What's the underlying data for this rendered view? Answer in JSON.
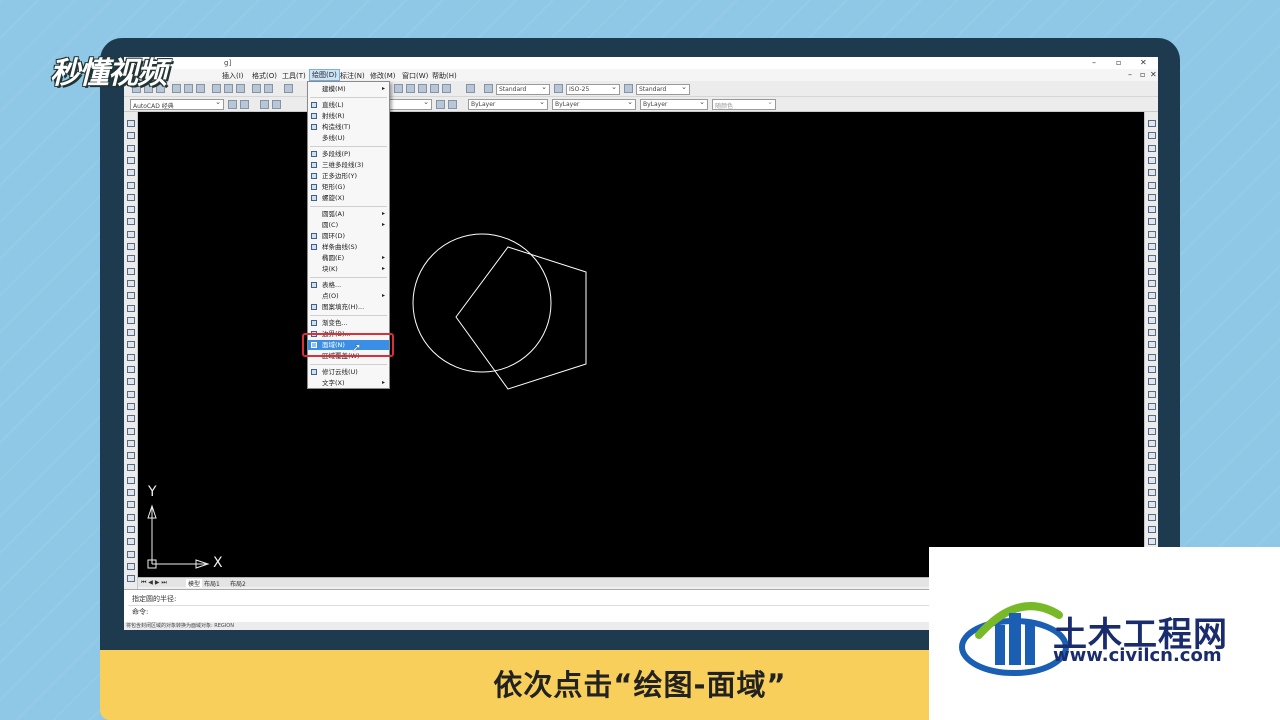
{
  "brand": {
    "logo_text": "秒懂视频"
  },
  "caption": "依次点击“绘图-面域”",
  "watermark": {
    "name": "土木工程网",
    "url": "www.civilcn.com"
  },
  "window": {
    "title_fragment": "g]",
    "controls": [
      "–",
      "▫",
      "✕"
    ],
    "inner_controls": [
      "–",
      "▫",
      "✕"
    ]
  },
  "menubar": {
    "items": [
      {
        "label": "插入(I)"
      },
      {
        "label": "格式(O)"
      },
      {
        "label": "工具(T)"
      },
      {
        "label": "绘图(D)",
        "active": true
      },
      {
        "label": "标注(N)"
      },
      {
        "label": "修改(M)"
      },
      {
        "label": "窗口(W)"
      },
      {
        "label": "帮助(H)"
      }
    ]
  },
  "toolbar": {
    "workspace": "AutoCAD 经典",
    "text_style": "Standard",
    "dim_style": "ISO-25",
    "table_style": "Standard",
    "layer_color": "ByLayer",
    "linetype": "ByLayer",
    "lineweight": "ByLayer",
    "plot_style": "随颜色"
  },
  "draw_menu": {
    "items": [
      {
        "label": "建模(M)",
        "submenu": true,
        "icon": "none"
      },
      {
        "label": "直线(L)",
        "icon": "line-icon"
      },
      {
        "label": "射线(R)",
        "icon": "ray-icon"
      },
      {
        "label": "构造线(T)",
        "icon": "xline-icon"
      },
      {
        "label": "多线(U)",
        "icon": "none"
      },
      {
        "label": "多段线(P)",
        "icon": "polyline-icon"
      },
      {
        "label": "三维多段线(3)",
        "icon": "3dpoly-icon"
      },
      {
        "label": "正多边形(Y)",
        "icon": "polygon-icon"
      },
      {
        "label": "矩形(G)",
        "icon": "rectangle-icon"
      },
      {
        "label": "螺旋(X)",
        "icon": "helix-icon"
      },
      {
        "label": "圆弧(A)",
        "submenu": true,
        "icon": "none"
      },
      {
        "label": "圆(C)",
        "submenu": true,
        "icon": "none"
      },
      {
        "label": "圆环(D)",
        "icon": "donut-icon"
      },
      {
        "label": "样条曲线(S)",
        "icon": "spline-icon"
      },
      {
        "label": "椭圆(E)",
        "submenu": true,
        "icon": "none"
      },
      {
        "label": "块(K)",
        "submenu": true,
        "icon": "none"
      },
      {
        "label": "表格...",
        "icon": "table-icon"
      },
      {
        "label": "点(O)",
        "submenu": true,
        "icon": "none"
      },
      {
        "label": "图案填充(H)...",
        "icon": "hatch-icon"
      },
      {
        "label": "渐变色...",
        "icon": "gradient-icon"
      },
      {
        "label": "边界(B)...",
        "icon": "boundary-icon"
      },
      {
        "label": "面域(N)",
        "icon": "region-icon",
        "selected": true
      },
      {
        "label": "区域覆盖(W)",
        "icon": "none"
      },
      {
        "label": "修订云线(U)",
        "icon": "revcloud-icon"
      },
      {
        "label": "文字(X)",
        "submenu": true,
        "icon": "none"
      }
    ]
  },
  "canvas": {
    "axis_x": "X",
    "axis_y": "Y",
    "background": "#000000",
    "stroke": "#ffffff"
  },
  "layout_tabs": [
    "模型",
    "布局1",
    "布局2"
  ],
  "command": {
    "history": "指定圆的半径:",
    "prompt": "命令:"
  },
  "status": {
    "text": "将包含封闭区域的对象转换为面域对象:  REGION"
  }
}
